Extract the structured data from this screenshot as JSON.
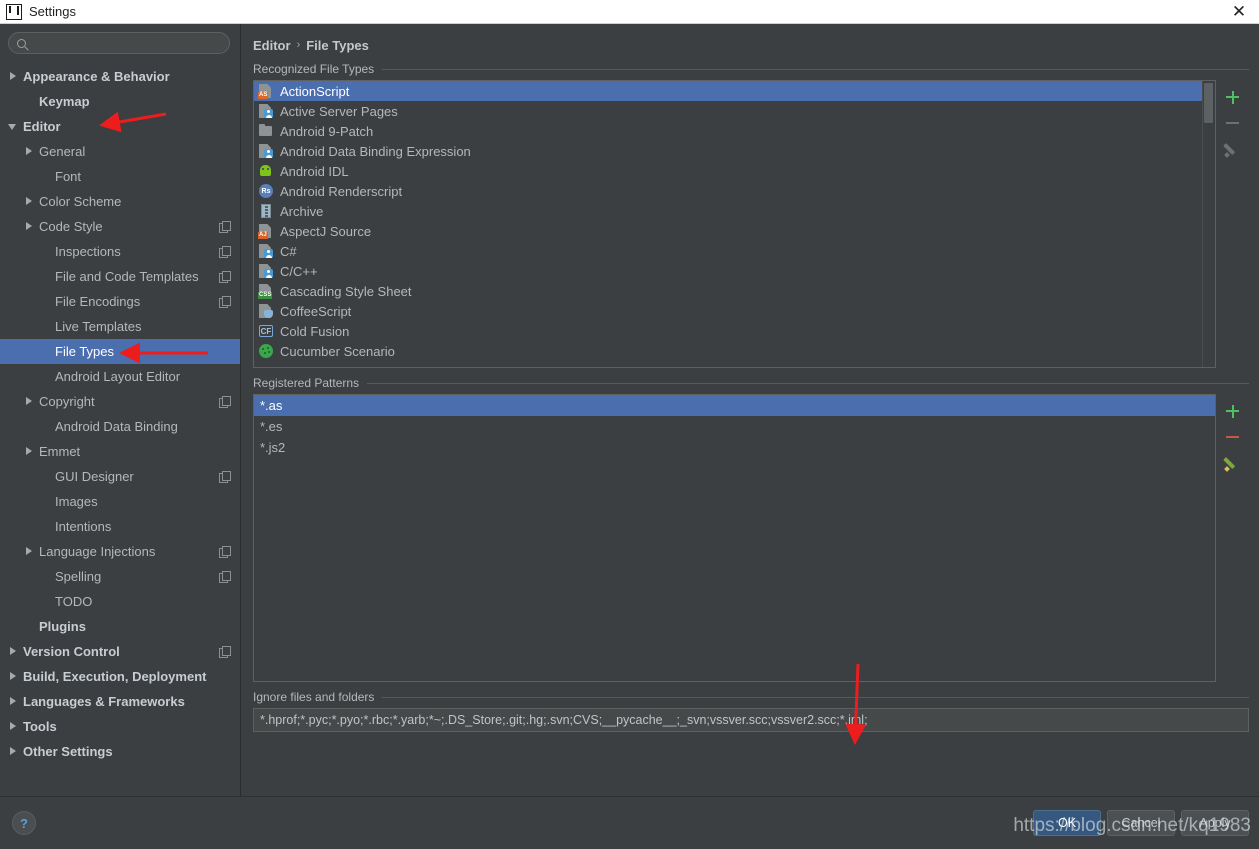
{
  "window": {
    "title": "Settings",
    "app_icon": "intellij-idea-icon",
    "close_label": "✕"
  },
  "sidebar": {
    "search": {
      "value": "",
      "placeholder": "",
      "icon": "search-icon"
    },
    "items": [
      {
        "label": "Appearance & Behavior",
        "indent": 0,
        "twisty": "right",
        "bold": true,
        "badge": false,
        "selected": false
      },
      {
        "label": "Keymap",
        "indent": 1,
        "twisty": "none",
        "bold": true,
        "badge": false,
        "selected": false
      },
      {
        "label": "Editor",
        "indent": 0,
        "twisty": "down",
        "bold": true,
        "badge": false,
        "selected": false
      },
      {
        "label": "General",
        "indent": 1,
        "twisty": "right",
        "bold": false,
        "badge": false,
        "selected": false
      },
      {
        "label": "Font",
        "indent": 2,
        "twisty": "none",
        "bold": false,
        "badge": false,
        "selected": false
      },
      {
        "label": "Color Scheme",
        "indent": 1,
        "twisty": "right",
        "bold": false,
        "badge": false,
        "selected": false
      },
      {
        "label": "Code Style",
        "indent": 1,
        "twisty": "right",
        "bold": false,
        "badge": true,
        "selected": false
      },
      {
        "label": "Inspections",
        "indent": 2,
        "twisty": "none",
        "bold": false,
        "badge": true,
        "selected": false
      },
      {
        "label": "File and Code Templates",
        "indent": 2,
        "twisty": "none",
        "bold": false,
        "badge": true,
        "selected": false
      },
      {
        "label": "File Encodings",
        "indent": 2,
        "twisty": "none",
        "bold": false,
        "badge": true,
        "selected": false
      },
      {
        "label": "Live Templates",
        "indent": 2,
        "twisty": "none",
        "bold": false,
        "badge": false,
        "selected": false
      },
      {
        "label": "File Types",
        "indent": 2,
        "twisty": "none",
        "bold": false,
        "badge": false,
        "selected": true
      },
      {
        "label": "Android Layout Editor",
        "indent": 2,
        "twisty": "none",
        "bold": false,
        "badge": false,
        "selected": false
      },
      {
        "label": "Copyright",
        "indent": 1,
        "twisty": "right",
        "bold": false,
        "badge": true,
        "selected": false
      },
      {
        "label": "Android Data Binding",
        "indent": 2,
        "twisty": "none",
        "bold": false,
        "badge": false,
        "selected": false
      },
      {
        "label": "Emmet",
        "indent": 1,
        "twisty": "right",
        "bold": false,
        "badge": false,
        "selected": false
      },
      {
        "label": "GUI Designer",
        "indent": 2,
        "twisty": "none",
        "bold": false,
        "badge": true,
        "selected": false
      },
      {
        "label": "Images",
        "indent": 2,
        "twisty": "none",
        "bold": false,
        "badge": false,
        "selected": false
      },
      {
        "label": "Intentions",
        "indent": 2,
        "twisty": "none",
        "bold": false,
        "badge": false,
        "selected": false
      },
      {
        "label": "Language Injections",
        "indent": 1,
        "twisty": "right",
        "bold": false,
        "badge": true,
        "selected": false
      },
      {
        "label": "Spelling",
        "indent": 2,
        "twisty": "none",
        "bold": false,
        "badge": true,
        "selected": false
      },
      {
        "label": "TODO",
        "indent": 2,
        "twisty": "none",
        "bold": false,
        "badge": false,
        "selected": false
      },
      {
        "label": "Plugins",
        "indent": 1,
        "twisty": "none",
        "bold": true,
        "badge": false,
        "selected": false
      },
      {
        "label": "Version Control",
        "indent": 0,
        "twisty": "right",
        "bold": true,
        "badge": true,
        "selected": false
      },
      {
        "label": "Build, Execution, Deployment",
        "indent": 0,
        "twisty": "right",
        "bold": true,
        "badge": false,
        "selected": false
      },
      {
        "label": "Languages & Frameworks",
        "indent": 0,
        "twisty": "right",
        "bold": true,
        "badge": false,
        "selected": false
      },
      {
        "label": "Tools",
        "indent": 0,
        "twisty": "right",
        "bold": true,
        "badge": false,
        "selected": false
      },
      {
        "label": "Other Settings",
        "indent": 0,
        "twisty": "right",
        "bold": true,
        "badge": false,
        "selected": false
      }
    ]
  },
  "breadcrumb": {
    "parent": "Editor",
    "separator": "›",
    "current": "File Types"
  },
  "sections": {
    "recognized": "Recognized File Types",
    "patterns": "Registered Patterns",
    "ignore": "Ignore files and folders"
  },
  "file_types": [
    {
      "label": "ActionScript",
      "icon": "doc-as-icon",
      "selected": true
    },
    {
      "label": "Active Server Pages",
      "icon": "doc-person-icon",
      "selected": false
    },
    {
      "label": "Android 9-Patch",
      "icon": "folder-icon",
      "selected": false
    },
    {
      "label": "Android Data Binding Expression",
      "icon": "doc-person-icon",
      "selected": false
    },
    {
      "label": "Android IDL",
      "icon": "android-icon",
      "selected": false
    },
    {
      "label": "Android Renderscript",
      "icon": "rs-circle-icon",
      "selected": false
    },
    {
      "label": "Archive",
      "icon": "archive-icon",
      "selected": false
    },
    {
      "label": "AspectJ Source",
      "icon": "doc-aj-icon",
      "selected": false
    },
    {
      "label": "C#",
      "icon": "doc-person-icon",
      "selected": false
    },
    {
      "label": "C/C++",
      "icon": "doc-person-icon",
      "selected": false
    },
    {
      "label": "Cascading Style Sheet",
      "icon": "doc-css-icon",
      "selected": false
    },
    {
      "label": "CoffeeScript",
      "icon": "coffee-icon",
      "selected": false
    },
    {
      "label": "Cold Fusion",
      "icon": "cf-box-icon",
      "selected": false
    },
    {
      "label": "Cucumber Scenario",
      "icon": "cucumber-icon",
      "selected": false
    }
  ],
  "file_type_tools": [
    {
      "name": "add-file-type-button",
      "icon": "plus-icon",
      "enabled": true
    },
    {
      "name": "remove-file-type-button",
      "icon": "minus-icon",
      "enabled": false
    },
    {
      "name": "edit-file-type-button",
      "icon": "pencil-icon",
      "enabled": false
    }
  ],
  "patterns": [
    {
      "label": "*.as",
      "selected": true
    },
    {
      "label": "*.es",
      "selected": false
    },
    {
      "label": "*.js2",
      "selected": false
    }
  ],
  "pattern_tools": [
    {
      "name": "add-pattern-button",
      "icon": "plus-icon",
      "enabled": true
    },
    {
      "name": "remove-pattern-button",
      "icon": "minus-icon",
      "enabled": true
    },
    {
      "name": "edit-pattern-button",
      "icon": "pencil-icon",
      "enabled": true
    }
  ],
  "ignore_value": "*.hprof;*.pyc;*.pyo;*.rbc;*.yarb;*~;.DS_Store;.git;.hg;.svn;CVS;__pycache__;_svn;vssver.scc;vssver2.scc;*.iml;",
  "footer": {
    "help_label": "?",
    "ok": "OK",
    "cancel": "Cancel",
    "apply": "Apply"
  },
  "watermark": "https://blog.csdn.net/kq1983",
  "colors": {
    "selection_blue": "#4b6eaf",
    "primary_button": "#365880",
    "panel_bg": "#3c3f41",
    "annotation_red": "#ee1d1d"
  }
}
